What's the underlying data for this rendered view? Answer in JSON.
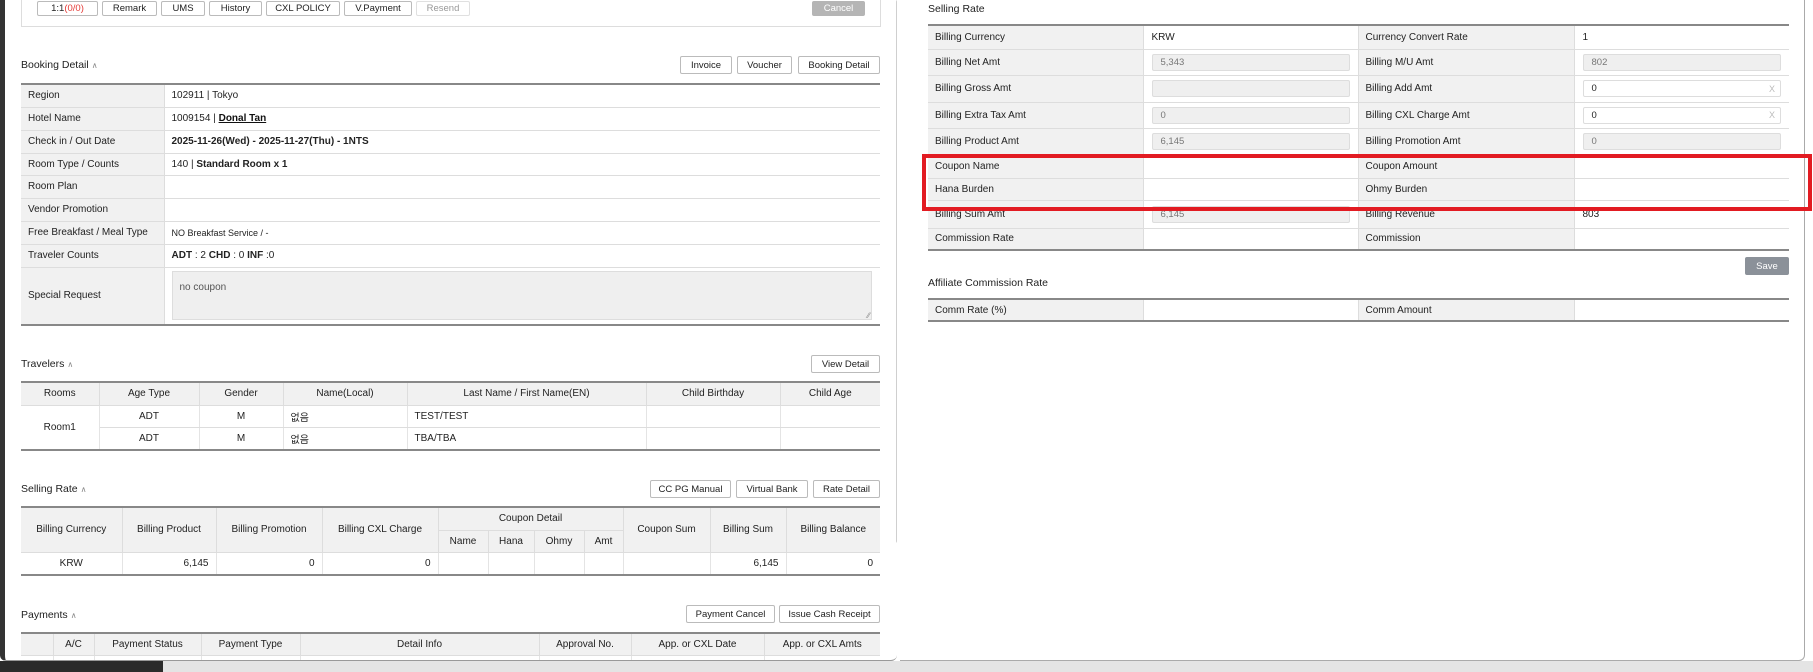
{
  "top_actions": {
    "buttons": [
      "1:1 ",
      "Remark",
      "UMS",
      "History",
      "CXL POLICY",
      "V.Payment",
      "Resend"
    ],
    "chat_count": "(0/0)",
    "cancel": "Cancel"
  },
  "booking_detail": {
    "title": "Booking Detail",
    "buttons": [
      "Invoice",
      "Voucher",
      "Booking Detail"
    ],
    "rows": [
      {
        "label": "Region",
        "value": "102911 | Tokyo"
      },
      {
        "label": "Hotel Name",
        "code": "1009154 | ",
        "link": "Donal Tan"
      },
      {
        "label": "Check in / Out Date",
        "value": "2025-11-26(Wed) - 2025-11-27(Thu) - 1NTS"
      },
      {
        "label": "Room Type / Counts",
        "code": "140 | ",
        "bold": "Standard Room x 1"
      },
      {
        "label": "Room Plan",
        "value": ""
      },
      {
        "label": "Vendor Promotion",
        "value": ""
      },
      {
        "label": "Free Breakfast / Meal Type",
        "value": "NO Breakfast Service / -"
      },
      {
        "label": "Traveler Counts",
        "adt_label": "ADT",
        "adt": " : 2 ",
        "chd_label": "CHD",
        "chd": " : 0 ",
        "inf_label": "INF",
        "inf": " :0"
      },
      {
        "label": "Special Request",
        "value": "no coupon"
      }
    ]
  },
  "travelers": {
    "title": "Travelers",
    "button": "View Detail",
    "headers": [
      "Rooms",
      "Age Type",
      "Gender",
      "Name(Local)",
      "Last Name / First Name(EN)",
      "Child Birthday",
      "Child Age"
    ],
    "room": "Room1",
    "rows": [
      {
        "age_type": "ADT",
        "gender": "M",
        "name_local": "없음",
        "name_en": "TEST/TEST",
        "birthday": "",
        "age": ""
      },
      {
        "age_type": "ADT",
        "gender": "M",
        "name_local": "없음",
        "name_en": "TBA/TBA",
        "birthday": "",
        "age": ""
      }
    ]
  },
  "selling_rate_left": {
    "title": "Selling Rate",
    "buttons": [
      "CC PG Manual",
      "Virtual Bank",
      "Rate Detail"
    ],
    "headers": {
      "currency": "Billing Currency",
      "product": "Billing Product",
      "promotion": "Billing Promotion",
      "cxl": "Billing CXL Charge",
      "coupon_detail": "Coupon Detail",
      "name": "Name",
      "hana": "Hana",
      "ohmy": "Ohmy",
      "amt": "Amt",
      "coupon_sum": "Coupon Sum",
      "sum": "Billing Sum",
      "balance": "Billing Balance"
    },
    "row": {
      "currency": "KRW",
      "product": "6,145",
      "promotion": "0",
      "cxl": "0",
      "name": "",
      "hana": "",
      "ohmy": "",
      "amt": "",
      "coupon_sum": "",
      "sum": "6,145",
      "balance": "0"
    }
  },
  "payments": {
    "title": "Payments",
    "buttons": [
      "Payment Cancel",
      "Issue Cash Receipt"
    ],
    "headers": [
      "",
      "A/C",
      "Payment Status",
      "Payment Type",
      "Detail Info",
      "Approval No.",
      "App. or CXL Date",
      "App. or CXL Amts"
    ]
  },
  "selling_rate_right": {
    "title": "Selling Rate",
    "rows": [
      {
        "l1": "Billing Currency",
        "v1": "KRW",
        "l2": "Currency Convert Rate",
        "v2": "1"
      },
      {
        "l1": "Billing Net Amt",
        "v1": "5,343",
        "l2": "Billing M/U Amt",
        "v2": "802"
      },
      {
        "l1": "Billing Gross Amt",
        "v1": "",
        "l2": "Billing Add Amt",
        "v2": "0"
      },
      {
        "l1": "Billing Extra Tax Amt",
        "v1": "0",
        "l2": "Billing CXL Charge Amt",
        "v2": "0"
      },
      {
        "l1": "Billing Product Amt",
        "v1": "6,145",
        "l2": "Billing Promotion Amt",
        "v2": "0"
      },
      {
        "l1": "Coupon Name",
        "v1": "",
        "l2": "Coupon Amount",
        "v2": ""
      },
      {
        "l1": "Hana Burden",
        "v1": "",
        "l2": "Ohmy Burden",
        "v2": ""
      },
      {
        "l1": "Billing Sum Amt",
        "v1": "6,145",
        "l2": "Billing Revenue",
        "v2": "803"
      },
      {
        "l1": "Commission Rate",
        "v1": "",
        "l2": "Commission",
        "v2": ""
      }
    ],
    "clear": "X",
    "save": "Save"
  },
  "affiliate": {
    "title": "Affiliate Commission Rate",
    "l1": "Comm Rate (%)",
    "v1": "",
    "l2": "Comm Amount",
    "v2": ""
  },
  "colors": {
    "highlight": "#e21b22",
    "label_bg": "#f1f1f1",
    "chat_count": "#e53935"
  }
}
